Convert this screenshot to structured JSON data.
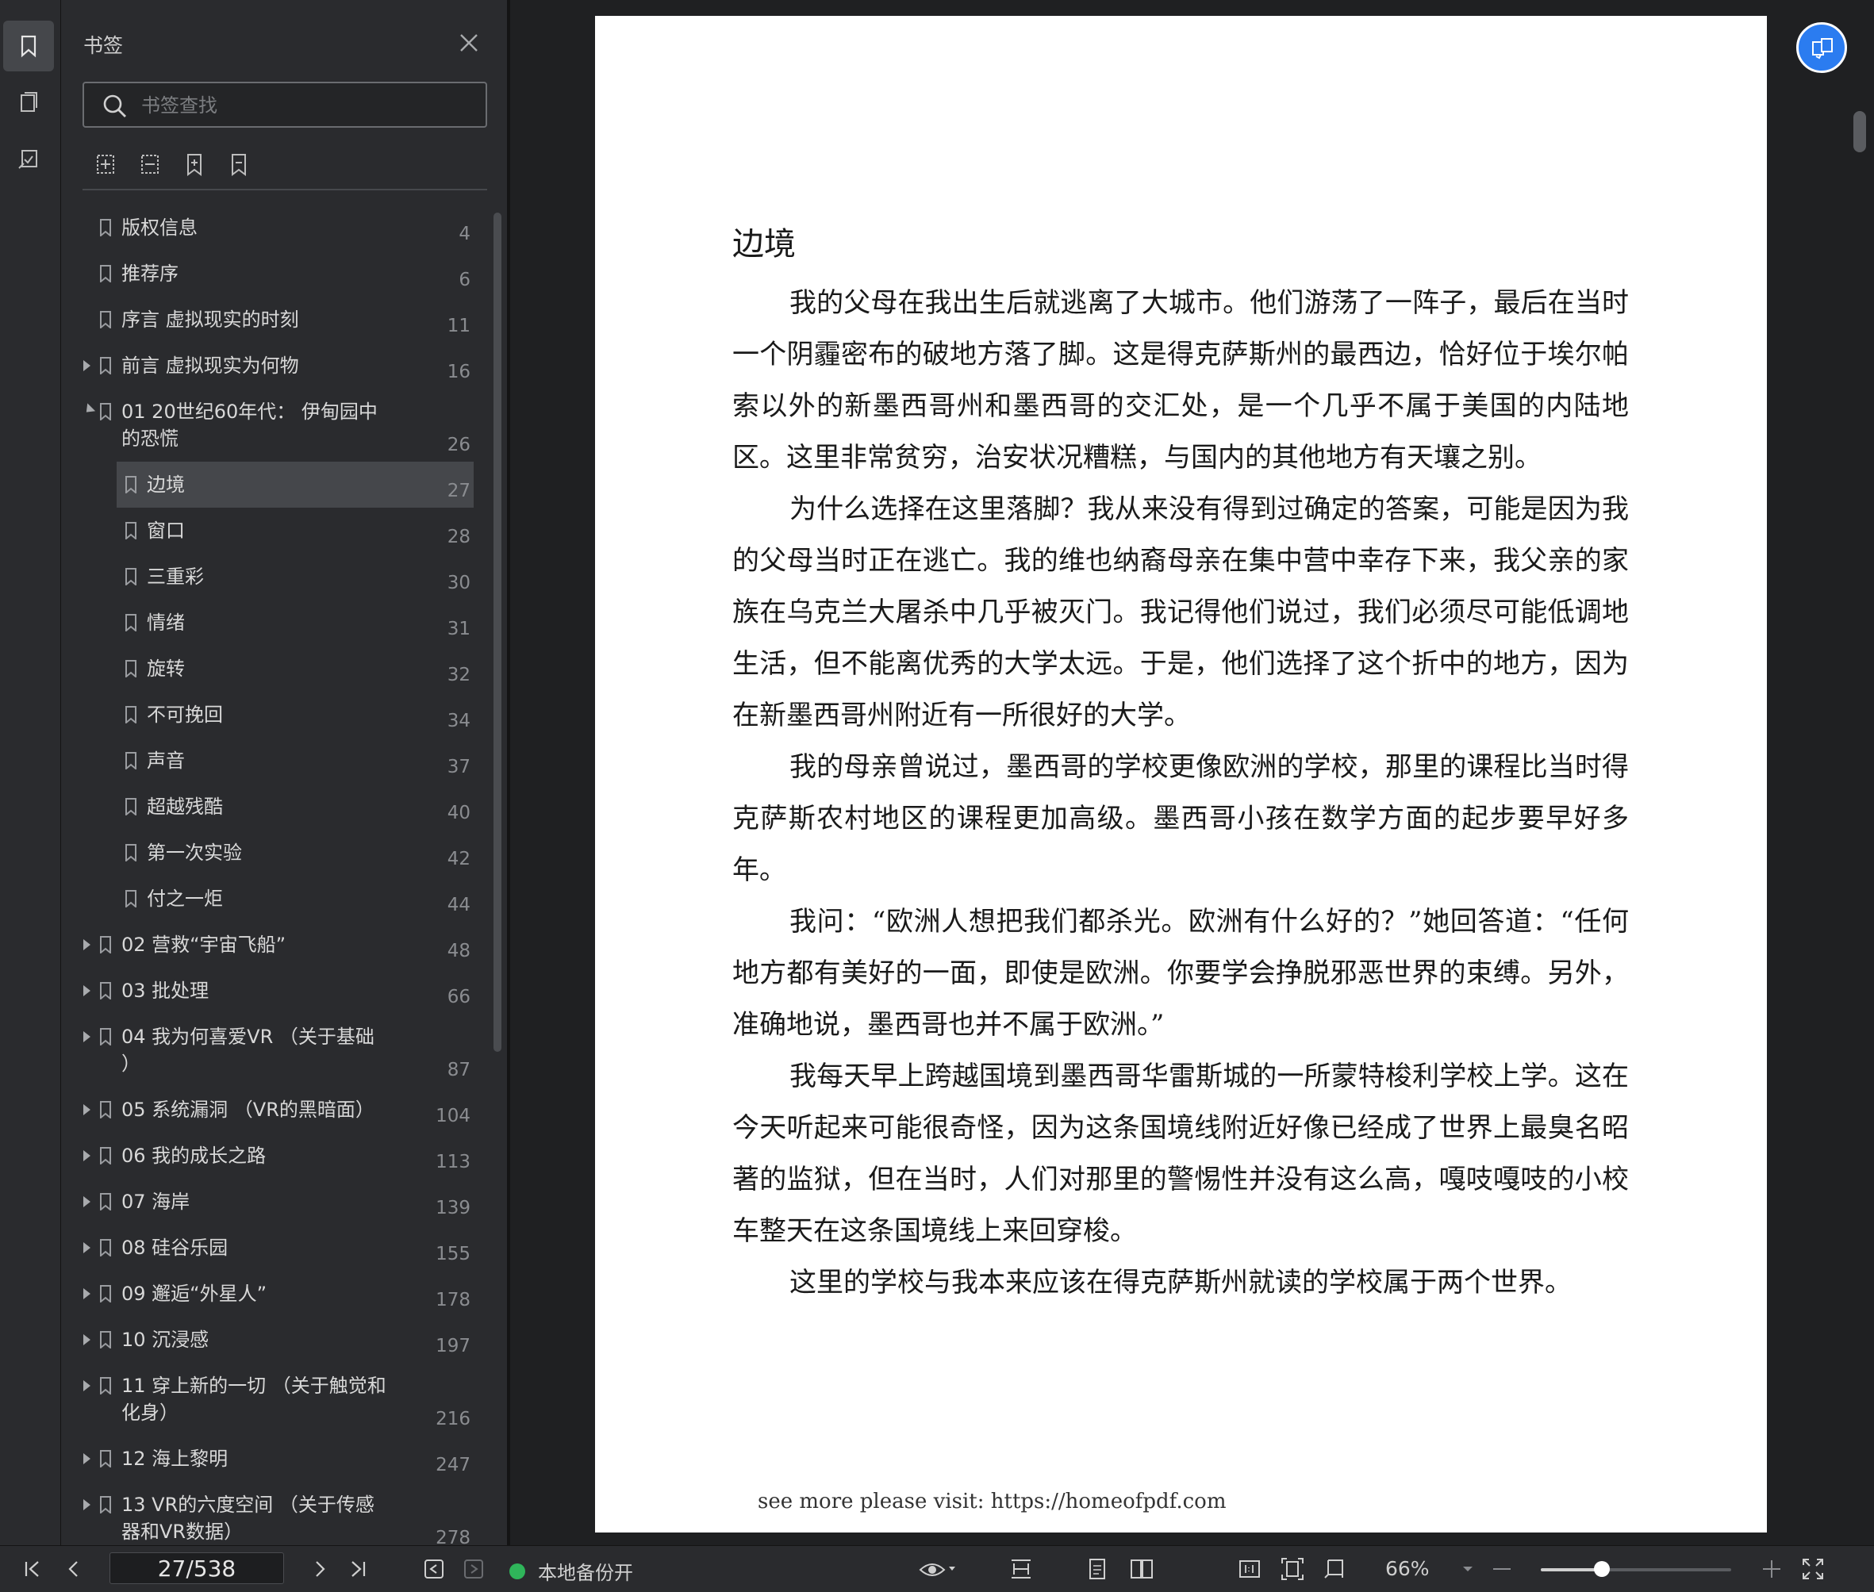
{
  "sidebar": {
    "title": "书签",
    "search_placeholder": "书签查找",
    "bookmarks": [
      {
        "label": "版权信息",
        "page": "4",
        "level": 0,
        "expander": "none"
      },
      {
        "label": "推荐序",
        "page": "6",
        "level": 0,
        "expander": "none"
      },
      {
        "label": "序言 虚拟现实的时刻",
        "page": "11",
        "level": 0,
        "expander": "none"
      },
      {
        "label": "前言 虚拟现实为何物",
        "page": "16",
        "level": 0,
        "expander": "collapsed"
      },
      {
        "label": "01 20世纪60年代： 伊甸园中\n的恐慌",
        "page": "26",
        "level": 0,
        "expander": "expanded"
      },
      {
        "label": "边境",
        "page": "27",
        "level": 1,
        "expander": "none",
        "selected": true
      },
      {
        "label": "窗口",
        "page": "28",
        "level": 1,
        "expander": "none"
      },
      {
        "label": "三重彩",
        "page": "30",
        "level": 1,
        "expander": "none"
      },
      {
        "label": "情绪",
        "page": "31",
        "level": 1,
        "expander": "none"
      },
      {
        "label": "旋转",
        "page": "32",
        "level": 1,
        "expander": "none"
      },
      {
        "label": "不可挽回",
        "page": "34",
        "level": 1,
        "expander": "none"
      },
      {
        "label": "声音",
        "page": "37",
        "level": 1,
        "expander": "none"
      },
      {
        "label": "超越残酷",
        "page": "40",
        "level": 1,
        "expander": "none"
      },
      {
        "label": "第一次实验",
        "page": "42",
        "level": 1,
        "expander": "none"
      },
      {
        "label": "付之一炬",
        "page": "44",
        "level": 1,
        "expander": "none"
      },
      {
        "label": "02 营救“宇宙飞船”",
        "page": "48",
        "level": 0,
        "expander": "collapsed"
      },
      {
        "label": "03 批处理",
        "page": "66",
        "level": 0,
        "expander": "collapsed"
      },
      {
        "label": "04 我为何喜爱VR （关于基础\n）",
        "page": "87",
        "level": 0,
        "expander": "collapsed"
      },
      {
        "label": "05 系统漏洞 （VR的黑暗面）",
        "page": "104",
        "level": 0,
        "expander": "collapsed"
      },
      {
        "label": "06 我的成长之路",
        "page": "113",
        "level": 0,
        "expander": "collapsed"
      },
      {
        "label": "07 海岸",
        "page": "139",
        "level": 0,
        "expander": "collapsed"
      },
      {
        "label": "08 硅谷乐园",
        "page": "155",
        "level": 0,
        "expander": "collapsed"
      },
      {
        "label": "09 邂逅“外星人”",
        "page": "178",
        "level": 0,
        "expander": "collapsed"
      },
      {
        "label": "10 沉浸感",
        "page": "197",
        "level": 0,
        "expander": "collapsed"
      },
      {
        "label": "11 穿上新的一切 （关于触觉和\n化身）",
        "page": "216",
        "level": 0,
        "expander": "collapsed"
      },
      {
        "label": "12 海上黎明",
        "page": "247",
        "level": 0,
        "expander": "collapsed"
      },
      {
        "label": "13 VR的六度空间 （关于传感\n器和VR数据）",
        "page": "278",
        "level": 0,
        "expander": "collapsed"
      }
    ]
  },
  "document": {
    "chapter_title": "边境",
    "paragraphs": [
      "我的父母在我出生后就逃离了大城市。他们游荡了一阵子，最后在当时一个阴霾密布的破地方落了脚。这是得克萨斯州的最西边，恰好位于埃尔帕索以外的新墨西哥州和墨西哥的交汇处，是一个几乎不属于美国的内陆地区。这里非常贫穷，治安状况糟糕，与国内的其他地方有天壤之别。",
      "为什么选择在这里落脚？我从来没有得到过确定的答案，可能是因为我的父母当时正在逃亡。我的维也纳裔母亲在集中营中幸存下来，我父亲的家族在乌克兰大屠杀中几乎被灭门。我记得他们说过，我们必须尽可能低调地生活，但不能离优秀的大学太远。于是，他们选择了这个折中的地方，因为在新墨西哥州附近有一所很好的大学。",
      "我的母亲曾说过，墨西哥的学校更像欧洲的学校，那里的课程比当时得克萨斯农村地区的课程更加高级。墨西哥小孩在数学方面的起步要早好多年。",
      "我问：“欧洲人想把我们都杀光。欧洲有什么好的？”她回答道：“任何地方都有美好的一面，即使是欧洲。你要学会挣脱邪恶世界的束缚。另外，准确地说，墨西哥也并不属于欧洲。”",
      "我每天早上跨越国境到墨西哥华雷斯城的一所蒙特梭利学校上学。这在今天听起来可能很奇怪，因为这条国境线附近好像已经成了世界上最臭名昭著的监狱，但在当时，人们对那里的警惕性并没有这么高，嘎吱嘎吱的小校车整天在这条国境线上来回穿梭。",
      "这里的学校与我本来应该在得克萨斯州就读的学校属于两个世界。"
    ],
    "footer_note": "see more please visit: https://homeofpdf.com"
  },
  "statusbar": {
    "page_indicator": "27/538",
    "backup_status": "本地备份开",
    "zoom_level": "66%",
    "zoom_fraction": 0.32
  }
}
